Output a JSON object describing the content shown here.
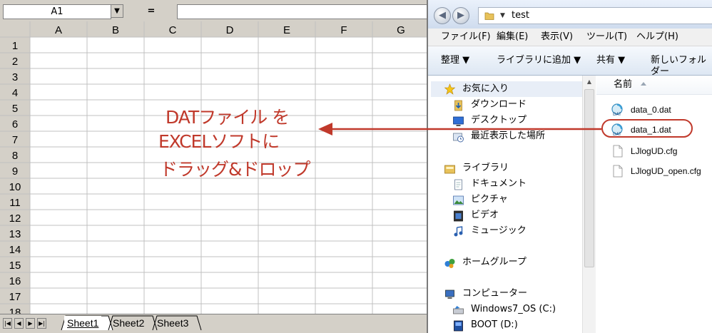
{
  "excel": {
    "name_box": "A1",
    "formula_label": "=",
    "formula_value": "",
    "columns": [
      "A",
      "B",
      "C",
      "D",
      "E",
      "F",
      "G"
    ],
    "rows": [
      "1",
      "2",
      "3",
      "4",
      "5",
      "6",
      "7",
      "8",
      "9",
      "10",
      "11",
      "12",
      "13",
      "14",
      "15",
      "16",
      "17",
      "18"
    ],
    "sheet_tabs": [
      "Sheet1",
      "Sheet2",
      "Sheet3"
    ],
    "active_sheet": "Sheet1"
  },
  "annotation": {
    "line1": "DATファイル を",
    "line2": "EXCELソフトに",
    "line3": "ドラッグ&ドロップ",
    "color": "#c0392b"
  },
  "explorer": {
    "path": "test",
    "menu": [
      "ファイル(F)",
      "編集(E)",
      "表示(V)",
      "ツール(T)",
      "ヘルプ(H)"
    ],
    "toolbar": [
      "整理 ▼",
      "ライブラリに追加 ▼",
      "共有 ▼",
      "新しいフォルダー"
    ],
    "nav": {
      "favorites": "お気に入り",
      "favorites_items": [
        "ダウンロード",
        "デスクトップ",
        "最近表示した場所"
      ],
      "libraries": "ライブラリ",
      "libraries_items": [
        "ドキュメント",
        "ピクチャ",
        "ビデオ",
        "ミュージック"
      ],
      "homegroup": "ホームグループ",
      "computer": "コンピューター",
      "computer_items": [
        "Windows7_OS (C:)",
        "BOOT (D:)"
      ]
    },
    "column_header": "名前",
    "files": [
      {
        "name": "data_0.dat",
        "icon": "dat-file-icon"
      },
      {
        "name": "data_1.dat",
        "icon": "dat-file-icon"
      },
      {
        "name": "LJlogUD.cfg",
        "icon": "cfg-file-icon"
      },
      {
        "name": "LJlogUD_open.cfg",
        "icon": "cfg-file-icon"
      }
    ],
    "selected_file": "data_1.dat"
  }
}
